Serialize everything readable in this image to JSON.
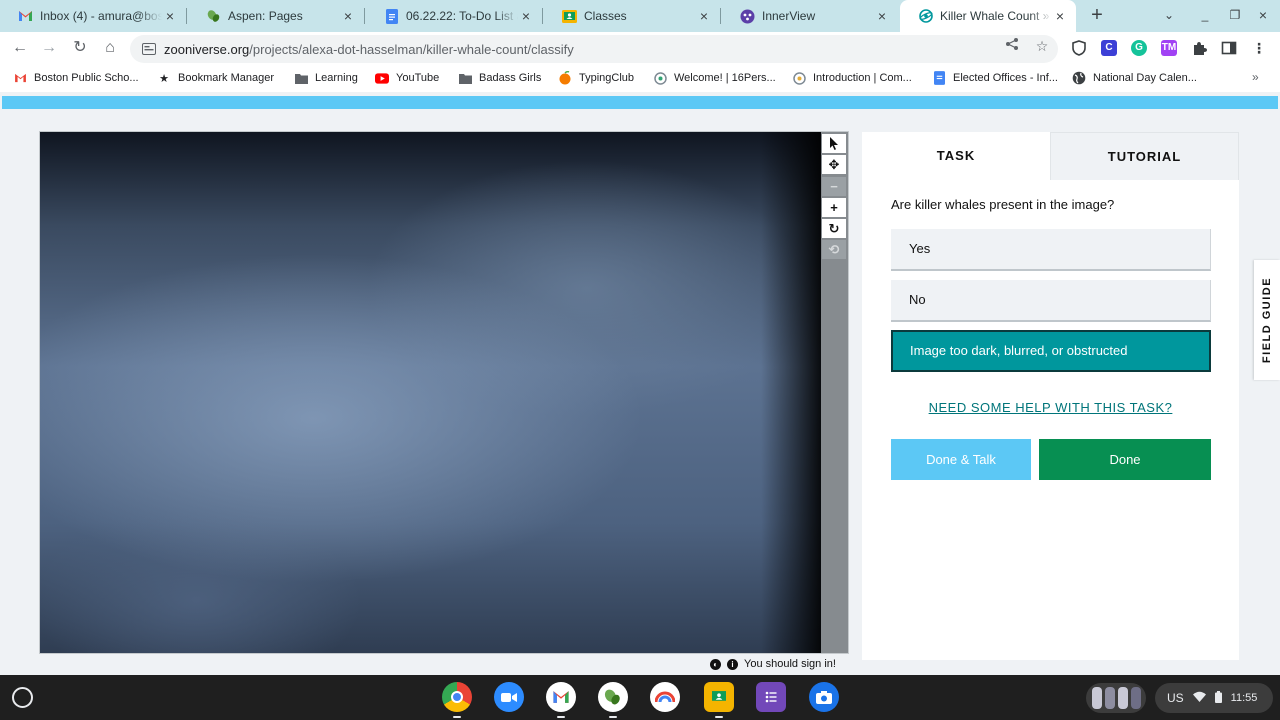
{
  "browser": {
    "tabs": [
      {
        "title": "Inbox (4) - amura@bost",
        "icon": "gmail-icon",
        "active": false
      },
      {
        "title": "Aspen: Pages",
        "icon": "aspen-leaf-icon",
        "active": false
      },
      {
        "title": "06.22.22: To-Do List and",
        "icon": "google-docs-icon",
        "active": false
      },
      {
        "title": "Classes",
        "icon": "google-classroom-icon",
        "active": false
      },
      {
        "title": "InnerView",
        "icon": "innerview-icon",
        "active": false
      },
      {
        "title": "Killer Whale Count » Cl",
        "icon": "zooniverse-icon",
        "active": true
      }
    ],
    "url_host": "zooniverse.org",
    "url_path": "/projects/alexa-dot-hasselman/killer-whale-count/classify",
    "bookmarks": [
      {
        "label": "Boston Public Scho...",
        "icon": "gmail-icon"
      },
      {
        "label": "Bookmark Manager",
        "icon": "star-icon"
      },
      {
        "label": "Learning",
        "icon": "folder-icon"
      },
      {
        "label": "YouTube",
        "icon": "youtube-icon"
      },
      {
        "label": "Badass Girls",
        "icon": "folder-icon"
      },
      {
        "label": "TypingClub",
        "icon": "typingclub-icon"
      },
      {
        "label": "Welcome! | 16Pers...",
        "icon": "16personalities-icon"
      },
      {
        "label": "Introduction | Com...",
        "icon": "16personalities-icon"
      },
      {
        "label": "Elected Offices - Inf...",
        "icon": "google-docs-icon"
      },
      {
        "label": "National Day Calen...",
        "icon": "globe-icon"
      }
    ],
    "bookmarks_more": "»"
  },
  "classifier": {
    "tabs": {
      "task": "TASK",
      "tutorial": "TUTORIAL"
    },
    "question": "Are killer whales present in the image?",
    "answers": [
      {
        "label": "Yes",
        "selected": false
      },
      {
        "label": "No",
        "selected": false
      },
      {
        "label": "Image too dark, blurred, or obstructed",
        "selected": true
      }
    ],
    "help_link": "NEED SOME HELP WITH THIS TASK?",
    "done_talk": "Done & Talk",
    "done": "Done",
    "field_guide": "FIELD GUIDE",
    "sign_in_note": "You should sign in!"
  },
  "colors": {
    "zooniverse_blue": "#5cc8f5",
    "selected_answer": "#00979d",
    "done_green": "#078f52",
    "tab_strip": "#c7e4ea"
  },
  "shelf": {
    "apps": [
      "chrome-icon",
      "zoom-icon",
      "gmail-icon",
      "aspen-leaf-icon",
      "chrome-canvas-icon",
      "google-classroom-icon",
      "google-forms-icon",
      "camera-icon"
    ],
    "locale": "US",
    "time": "11:55"
  }
}
